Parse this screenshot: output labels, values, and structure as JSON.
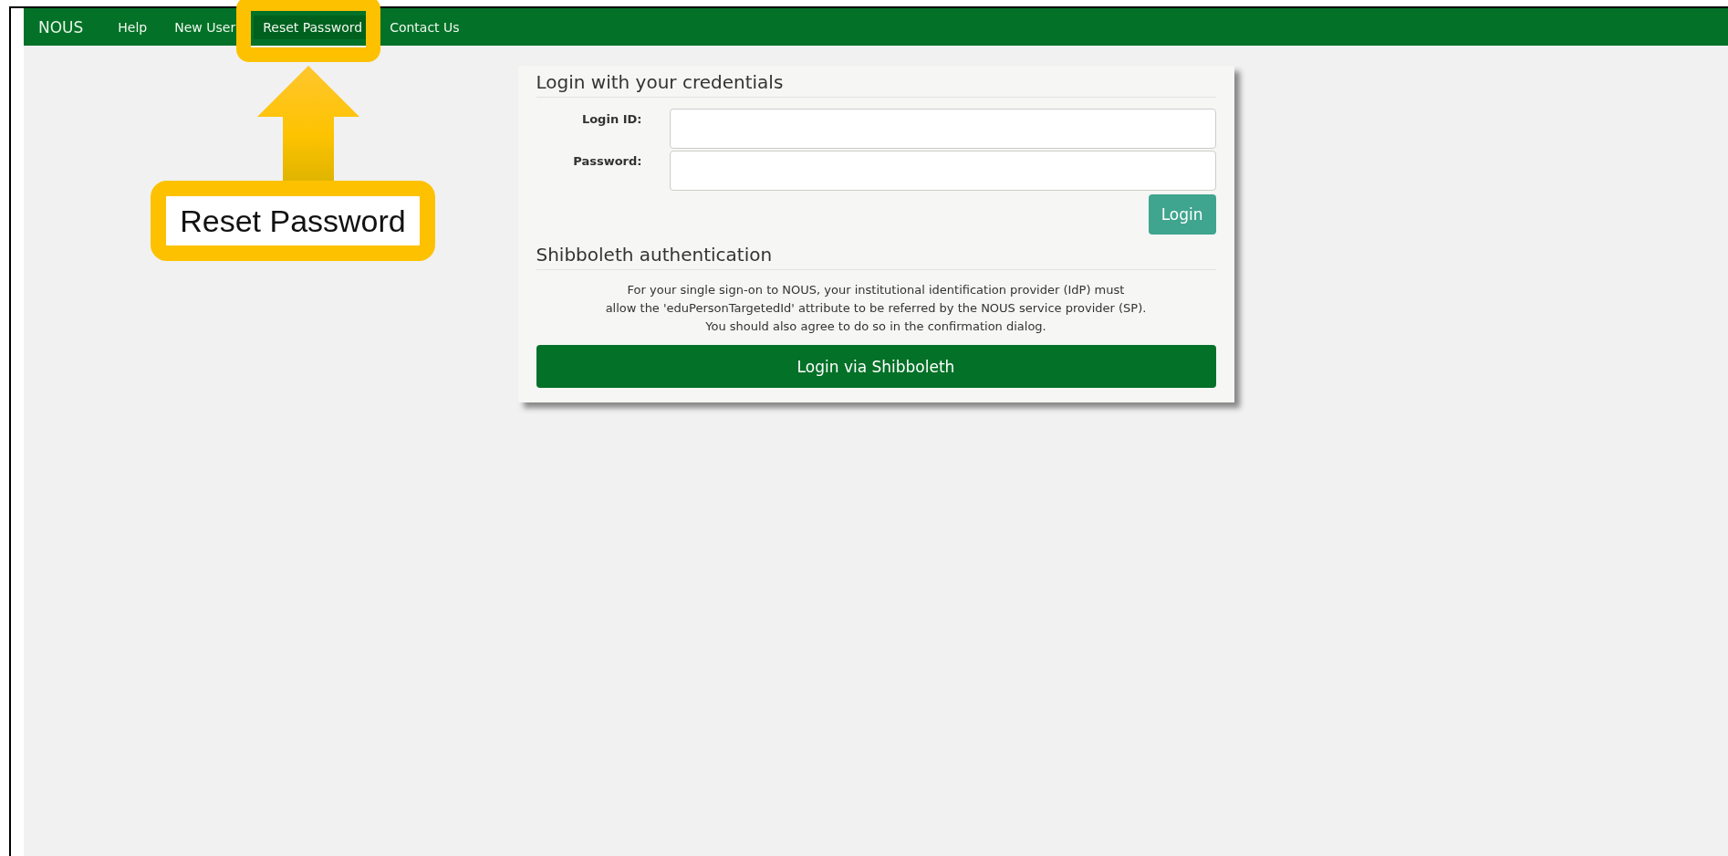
{
  "navbar": {
    "brand": "NOUS",
    "items": [
      {
        "label": "Help",
        "selected": false
      },
      {
        "label": "New User",
        "selected": false
      },
      {
        "label": "Reset Password",
        "selected": true
      },
      {
        "label": "Contact Us",
        "selected": false
      }
    ]
  },
  "callout": {
    "text": "Reset Password"
  },
  "login_form": {
    "title": "Login with your credentials",
    "fields": [
      {
        "label": "Login ID:"
      },
      {
        "label": "Password:"
      }
    ],
    "button": "Login"
  },
  "shibboleth": {
    "title": "Shibboleth authentication",
    "lines": [
      "For your single sign-on to NOUS, your institutional identification provider (IdP) must",
      "allow the 'eduPersonTargetedId' attribute to be referred by the NOUS service provider (SP).",
      "You should also agree to do so in the confirmation dialog."
    ],
    "button": "Login via Shibboleth"
  }
}
